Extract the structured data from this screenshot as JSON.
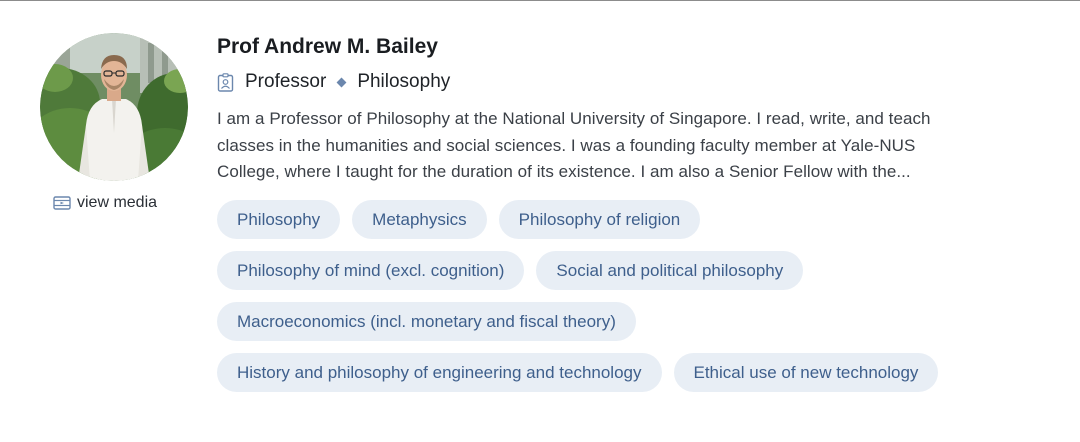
{
  "profile": {
    "name": "Prof Andrew M. Bailey",
    "role": "Professor",
    "field": "Philosophy",
    "bio_lines": [
      "I am a Professor of Philosophy at the National University of Singapore. I read, write, and teach",
      "classes in the humanities and social sciences. I was a founding faculty member at Yale-NUS",
      "College, where I taught for the duration of its existence. I am also a Senior Fellow with the..."
    ],
    "view_media_label": "view media"
  },
  "tags": [
    "Philosophy",
    "Metaphysics",
    "Philosophy of religion",
    "Philosophy of mind (excl. cognition)",
    "Social and political philosophy",
    "Macroeconomics (incl. monetary and fiscal theory)",
    "History and philosophy of engineering and technology",
    "Ethical use of new technology"
  ],
  "icons": {
    "role": "id-badge-icon",
    "separator": "diamond-icon",
    "media": "video-icon"
  },
  "colors": {
    "tag_bg": "#e8eef5",
    "tag_text": "#3e5f8c",
    "accent": "#6b87ad"
  }
}
